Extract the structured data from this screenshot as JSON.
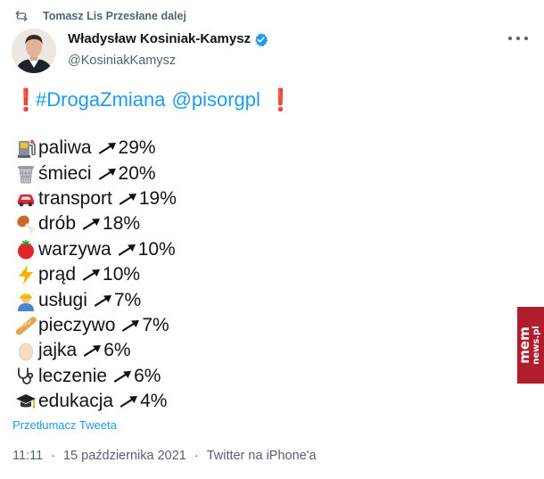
{
  "retweet": {
    "icon": "retweet-icon",
    "text": "Tomasz Lis Przesłane dalej"
  },
  "author": {
    "name": "Władysław Kosiniak-Kamysz",
    "handle": "@KosiniakKamysz",
    "verified": true,
    "avatar_icon": "user-avatar"
  },
  "tweet": {
    "headline": {
      "excl_left": "❗",
      "hashtag": "#DrogaZmiana",
      "mention": "@pisorgpl",
      "excl_right": "❗"
    },
    "items": [
      {
        "icon": "fuel-pump-icon",
        "label": "paliwa",
        "change": "29%"
      },
      {
        "icon": "wastebasket-icon",
        "label": "śmieci",
        "change": "20%"
      },
      {
        "icon": "car-icon",
        "label": "transport",
        "change": "19%"
      },
      {
        "icon": "poultry-leg-icon",
        "label": "drób",
        "change": "18%"
      },
      {
        "icon": "tomato-icon",
        "label": "warzywa",
        "change": "10%"
      },
      {
        "icon": "lightning-icon",
        "label": "prąd",
        "change": "10%"
      },
      {
        "icon": "worker-icon",
        "label": "usługi",
        "change": "7%"
      },
      {
        "icon": "baguette-icon",
        "label": "pieczywo",
        "change": "7%"
      },
      {
        "icon": "egg-icon",
        "label": "jajka",
        "change": "6%"
      },
      {
        "icon": "stethoscope-icon",
        "label": "leczenie",
        "change": "6%"
      },
      {
        "icon": "graduation-cap-icon",
        "label": "edukacja",
        "change": "4%"
      }
    ],
    "arrow_icon": "trend-up-arrow-icon"
  },
  "translate_link": "Przetłumacz Tweeta",
  "meta": {
    "time": "11:11",
    "sep1": "·",
    "date": "15 października 2021",
    "sep2": "·",
    "source": "Twitter na iPhone'a"
  },
  "watermark": {
    "line1": "mem",
    "line2": "news.pl"
  },
  "colors": {
    "link": "#1d9bf0",
    "secondary": "#536471",
    "text": "#0f1419",
    "watermark": "#b01e2e"
  }
}
